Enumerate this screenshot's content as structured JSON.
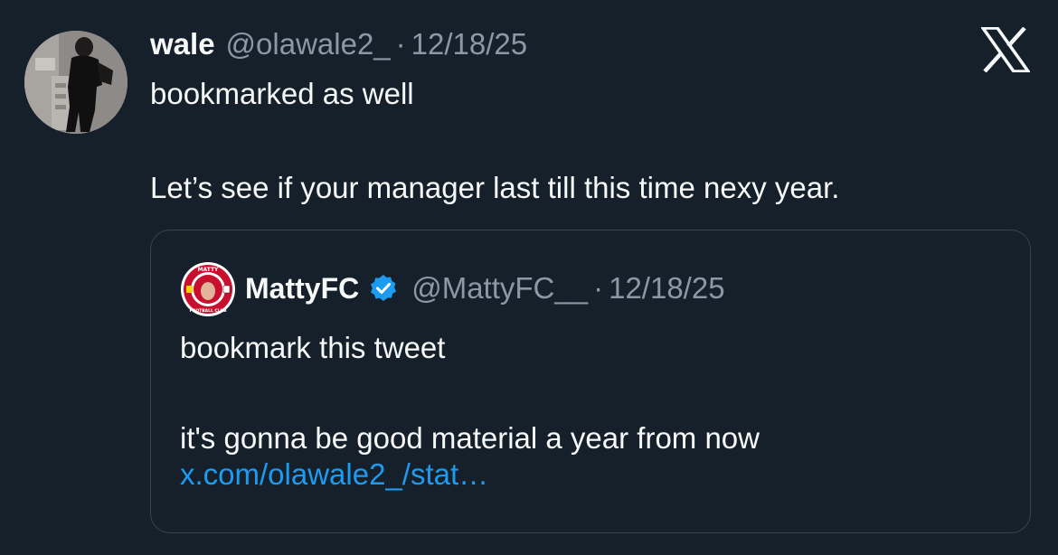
{
  "tweet": {
    "author_name": "wale",
    "author_handle": "@olawale2_",
    "separator": "·",
    "date": "12/18/25",
    "line1": "bookmarked as well",
    "line2": "Let’s see if your manager last till this time nexy year."
  },
  "quoted": {
    "author_name": "MattyFC",
    "author_handle": "@MattyFC__",
    "separator": "·",
    "date": "12/18/25",
    "line1": "bookmark this tweet",
    "line2": "it's gonna be good material a year from now",
    "link": "x.com/olawale2_/stat…",
    "logo_text_top": "MATTY",
    "logo_text_bottom": "FOOTBALL CLUB"
  },
  "colors": {
    "background": "#15202b",
    "text": "#f7f9f9",
    "muted": "#8b98a5",
    "link": "#1d9bf0",
    "border": "#38444d",
    "verified": "#1d9bf0"
  },
  "icons": {
    "platform_logo": "x-logo-icon",
    "verified": "verified-badge-icon"
  }
}
